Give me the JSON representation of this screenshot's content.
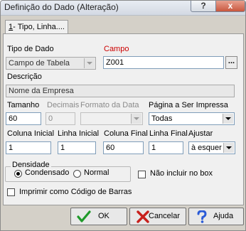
{
  "window": {
    "title": "Definição do Dado (Alteração)",
    "help_icon": "?",
    "close_icon": "x"
  },
  "tab": {
    "prefix": "1",
    "rest": "- Tipo, Linha...."
  },
  "tipo_dado": {
    "label": "Tipo de Dado",
    "value": "Campo de Tabela"
  },
  "campo": {
    "label": "Campo",
    "value": "Z001",
    "browse_label": "..."
  },
  "descricao": {
    "label": "Descrição",
    "value": "Nome da Empresa"
  },
  "tamanho": {
    "label": "Tamanho",
    "value": "60"
  },
  "decimais": {
    "label": "Decimais",
    "value": "0"
  },
  "formato": {
    "label": "Formato da Data",
    "value": ""
  },
  "pagina": {
    "label": "Página a Ser Impressa",
    "value": "Todas"
  },
  "coluna_inicial": {
    "label": "Coluna Inicial",
    "value": "1"
  },
  "linha_inicial": {
    "label": "Linha Inicial",
    "value": "1"
  },
  "coluna_final": {
    "label": "Coluna Final",
    "value": "60"
  },
  "linha_final": {
    "label": "Linha Final",
    "value": "1"
  },
  "ajustar": {
    "label": "Ajustar",
    "value": "à esquer"
  },
  "densidade": {
    "label": "Densidade",
    "options": [
      {
        "label": "Condensado",
        "selected": true
      },
      {
        "label": "Normal",
        "selected": false
      }
    ]
  },
  "nao_incluir": {
    "label": "Não incluir no box",
    "checked": false
  },
  "codigo_barras": {
    "label": "Imprimir como Código de Barras",
    "checked": false
  },
  "buttons": {
    "ok": "OK",
    "cancel": "Cancelar",
    "help": "Ajuda"
  },
  "colors": {
    "ok_check": "#1f9a2a",
    "cancel_x": "#c8201c",
    "help_q": "#2a5bd7",
    "required_label": "#cc0000"
  }
}
